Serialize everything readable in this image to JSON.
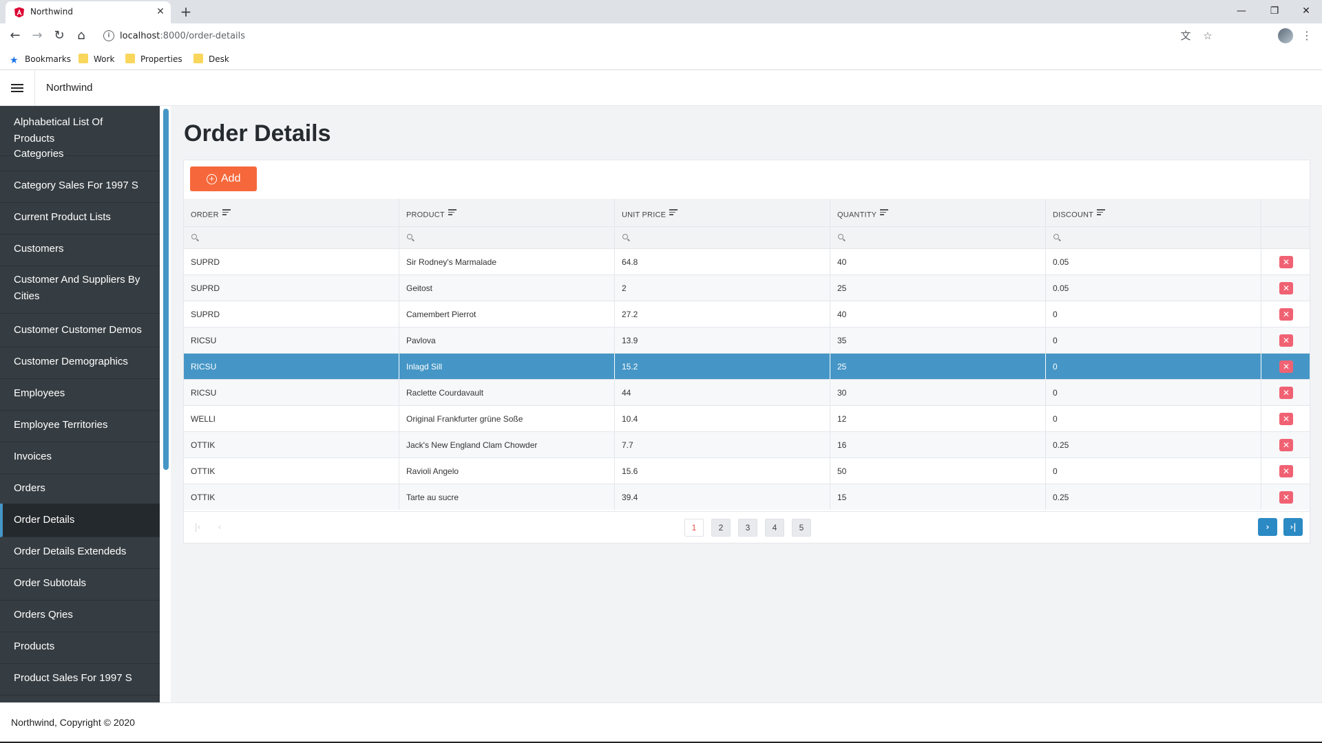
{
  "browser": {
    "tab_title": "Northwind",
    "url_host": "localhost",
    "url_rest": ":8000/order-details",
    "bookmarks": [
      "Bookmarks",
      "Work",
      "Properties",
      "Desk"
    ]
  },
  "app": {
    "title": "Northwind",
    "page_title": "Order Details",
    "add_label": "Add",
    "footer": "Northwind, Copyright © 2020"
  },
  "sidebar": {
    "items": [
      "Alphabetical List Of Products",
      "Categories",
      "Category Sales For 1997 S",
      "Current Product Lists",
      "Customers",
      "Customer And Suppliers By Cities",
      "Customer Customer Demos",
      "Customer Demographics",
      "Employees",
      "Employee Territories",
      "Invoices",
      "Orders",
      "Order Details",
      "Order Details Extendeds",
      "Order Subtotals",
      "Orders Qries",
      "Products",
      "Product Sales For 1997 S"
    ],
    "active": "Order Details"
  },
  "table": {
    "columns": [
      "ORDER",
      "PRODUCT",
      "UNIT PRICE",
      "QUANTITY",
      "DISCOUNT"
    ],
    "rows": [
      [
        "SUPRD",
        "Sir Rodney's Marmalade",
        "64.8",
        "40",
        "0.05"
      ],
      [
        "SUPRD",
        "Geitost",
        "2",
        "25",
        "0.05"
      ],
      [
        "SUPRD",
        "Camembert Pierrot",
        "27.2",
        "40",
        "0"
      ],
      [
        "RICSU",
        "Pavlova",
        "13.9",
        "35",
        "0"
      ],
      [
        "RICSU",
        "Inlagd Sill",
        "15.2",
        "25",
        "0"
      ],
      [
        "RICSU",
        "Raclette Courdavault",
        "44",
        "30",
        "0"
      ],
      [
        "WELLI",
        "Original Frankfurter grüne Soße",
        "10.4",
        "12",
        "0"
      ],
      [
        "OTTIK",
        "Jack's New England Clam Chowder",
        "7.7",
        "16",
        "0.25"
      ],
      [
        "OTTIK",
        "Ravioli Angelo",
        "15.6",
        "50",
        "0"
      ],
      [
        "OTTIK",
        "Tarte au sucre",
        "39.4",
        "15",
        "0.25"
      ]
    ],
    "selected_row": 4
  },
  "pager": {
    "pages": [
      "1",
      "2",
      "3",
      "4",
      "5"
    ],
    "current": "1"
  },
  "colors": {
    "accent": "#4596c6",
    "add_button": "#f6683b",
    "delete_button": "#f06273",
    "sidebar": "#363d42"
  }
}
